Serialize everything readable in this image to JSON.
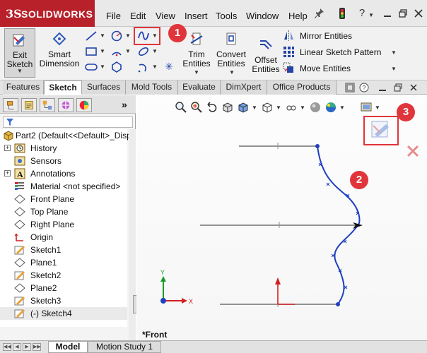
{
  "app": {
    "brand_mark": "3S",
    "brand_name": "SOLIDWORKS",
    "brand_color": "#b8202a"
  },
  "menu": [
    "File",
    "Edit",
    "View",
    "Insert",
    "Tools",
    "Window",
    "Help"
  ],
  "title_icons": [
    "pushpin-icon",
    "traffic-light-icon",
    "help-icon",
    "minimize-icon",
    "restore-icon",
    "close-icon"
  ],
  "command_manager": {
    "exit_sketch_label": "Exit Sketch",
    "smart_dimension_label": "Smart Dimension",
    "trim_label": "Trim Entities",
    "convert_label": "Convert Entities",
    "offset_label": "Offset Entities",
    "mirror_label": "Mirror Entities",
    "linear_pattern_label": "Linear Sketch Pattern",
    "move_label": "Move Entities",
    "selected_tool": "spline-tool"
  },
  "tabs": [
    "Features",
    "Sketch",
    "Surfaces",
    "Mold Tools",
    "Evaluate",
    "DimXpert",
    "Office Products"
  ],
  "active_tab": "Sketch",
  "feature_tree": {
    "root": "Part2  (Default<<Default>_Disp",
    "items": [
      {
        "label": "History",
        "icon": "history-icon",
        "expandable": true
      },
      {
        "label": "Sensors",
        "icon": "sensors-icon",
        "expandable": false
      },
      {
        "label": "Annotations",
        "icon": "annotations-icon",
        "expandable": true
      },
      {
        "label": "Material <not specified>",
        "icon": "material-icon",
        "expandable": false
      },
      {
        "label": "Front Plane",
        "icon": "plane-icon",
        "expandable": false
      },
      {
        "label": "Top Plane",
        "icon": "plane-icon",
        "expandable": false
      },
      {
        "label": "Right Plane",
        "icon": "plane-icon",
        "expandable": false
      },
      {
        "label": "Origin",
        "icon": "origin-icon",
        "expandable": false
      },
      {
        "label": "Sketch1",
        "icon": "sketch-icon",
        "expandable": false
      },
      {
        "label": "Plane1",
        "icon": "plane-icon",
        "expandable": false
      },
      {
        "label": "Sketch2",
        "icon": "sketch-icon",
        "expandable": false
      },
      {
        "label": "Plane2",
        "icon": "plane-icon",
        "expandable": false
      },
      {
        "label": "Sketch3",
        "icon": "sketch-icon",
        "expandable": false
      },
      {
        "label": "(-) Sketch4",
        "icon": "sketch-icon",
        "expandable": false
      }
    ]
  },
  "callouts": [
    "1",
    "2",
    "3"
  ],
  "callout_color": "#e0353b",
  "graphics": {
    "view_label": "*Front",
    "spline_color": "#1f3fbf",
    "axis_y_label": "Y",
    "axis_x_label": "X"
  },
  "bottom_tabs": [
    "Model",
    "Motion Study 1"
  ],
  "active_bottom_tab": "Model"
}
